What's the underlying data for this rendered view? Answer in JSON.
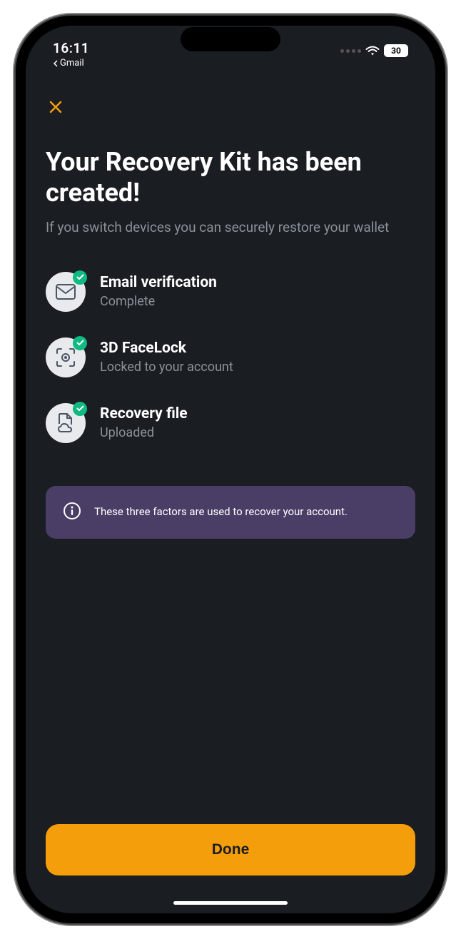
{
  "status": {
    "time": "16:11",
    "back_app": "Gmail",
    "battery": "30"
  },
  "screen": {
    "title": "Your Recovery Kit has been created!",
    "subtitle": "If you switch devices you can securely restore your wallet"
  },
  "steps": [
    {
      "title": "Email verification",
      "subtitle": "Complete"
    },
    {
      "title": "3D FaceLock",
      "subtitle": "Locked to your account"
    },
    {
      "title": "Recovery file",
      "subtitle": "Uploaded"
    }
  ],
  "info": {
    "text": "These three factors are used to recover your account."
  },
  "buttons": {
    "done": "Done"
  }
}
